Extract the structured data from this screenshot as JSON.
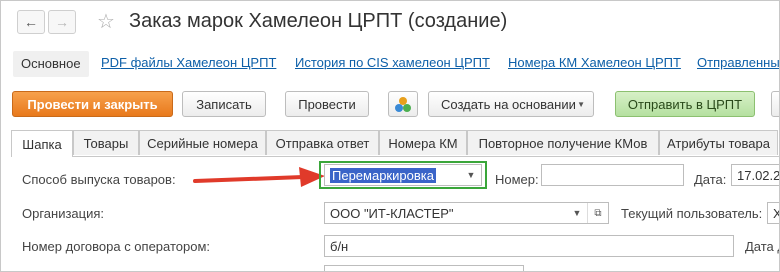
{
  "window": {
    "title": "Заказ марок Хамелеон ЦРПТ (создание)",
    "back_glyph": "←",
    "forward_glyph": "→",
    "star_glyph": "☆"
  },
  "links": {
    "main": "Основное",
    "pdf": "PDF файлы  Хамелеон ЦРПТ",
    "cis": "История по CIS хамелеон ЦРПТ",
    "km": "Номера КМ Хамелеон ЦРПТ",
    "sent": "Отправленны"
  },
  "toolbar": {
    "post_close": "Провести и закрыть",
    "save": "Записать",
    "post": "Провести",
    "create_based": "Создать на основании",
    "send": "Отправить в ЦРПТ"
  },
  "tabs": [
    "Шапка",
    "Товары",
    "Серийные номера",
    "Отправка ответ",
    "Номера КМ",
    "Повторное получение КМов",
    "Атрибуты товара"
  ],
  "form": {
    "release_method_label": "Способ выпуска товаров:",
    "release_method_value": "Перемаркировка",
    "number_label": "Номер:",
    "number_value": "",
    "date_label": "Дата:",
    "date_value": "17.02.2",
    "org_label": "Организация:",
    "org_value": "ООО \"ИТ-КЛАСТЕР\"",
    "current_user_label": "Текущий пользователь:",
    "current_user_value": "Х",
    "contract_label": "Номер договора с оператором:",
    "contract_value": "б/н",
    "contract_date_label": "Дата д"
  },
  "colors": {
    "accent_orange": "#e8791c",
    "arrow_red": "#e03a2a",
    "highlight_green": "#3aa63a",
    "link_blue": "#0d5fa8"
  }
}
